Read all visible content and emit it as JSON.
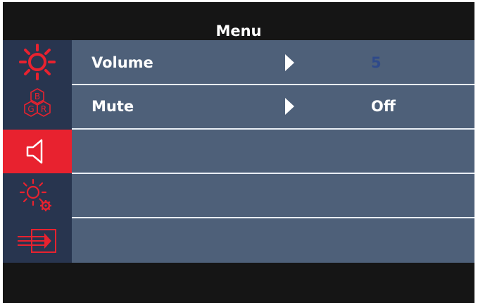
{
  "menu": {
    "title": "Menu"
  },
  "sidebar": {
    "items": [
      {
        "icon": "brightness-icon",
        "active": false
      },
      {
        "icon": "color-rgb-icon",
        "active": false,
        "letters": [
          "B",
          "G",
          "R"
        ]
      },
      {
        "icon": "speaker-icon",
        "active": true
      },
      {
        "icon": "settings-sun-gear-icon",
        "active": false
      },
      {
        "icon": "input-source-icon",
        "active": false
      }
    ]
  },
  "audio": {
    "rows": [
      {
        "label": "Volume",
        "value": "5"
      },
      {
        "label": "Mute",
        "value": "Off"
      }
    ]
  },
  "colors": {
    "frame": "#151515",
    "sidebar": "#28354f",
    "panel": "#4e6079",
    "active_red": "#e8222f",
    "icon_red": "#e8222f",
    "volume_value": "#2f4a8a"
  }
}
